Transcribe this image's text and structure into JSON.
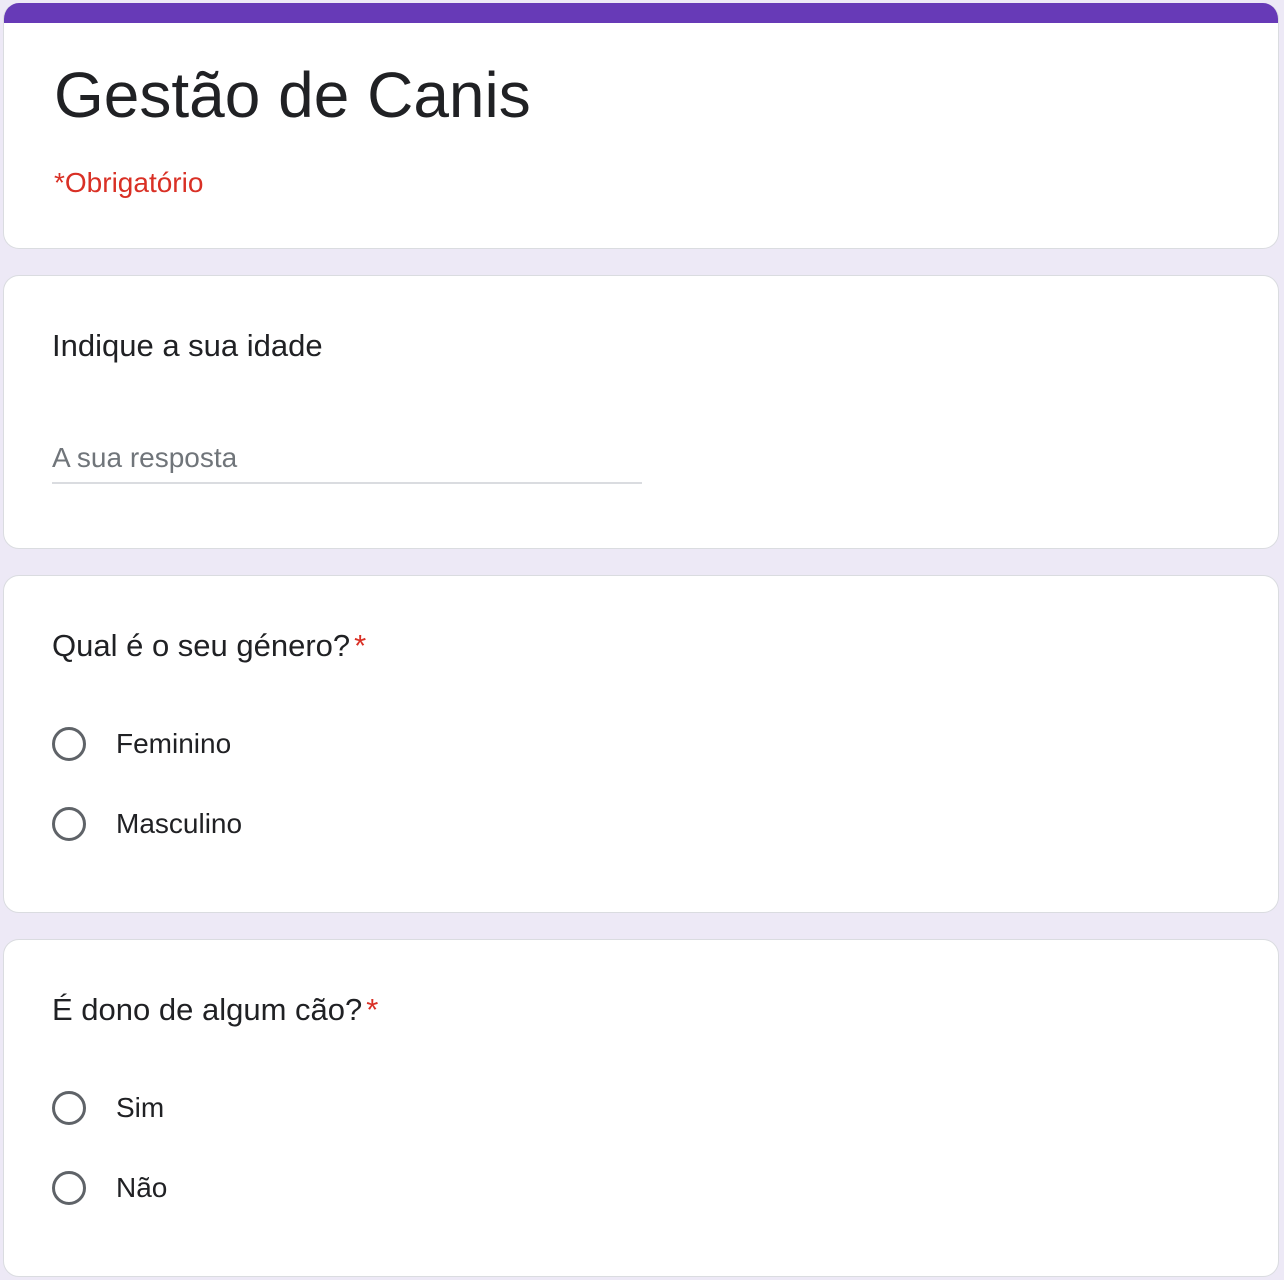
{
  "form": {
    "title": "Gestão de Canis",
    "required_note": "*Obrigatório",
    "accent_color": "#673ab7",
    "required_color": "#d93025"
  },
  "questions": [
    {
      "title": "Indique a sua idade",
      "type": "short-answer",
      "placeholder": "A sua resposta",
      "value": ""
    },
    {
      "title": "Qual é o seu género?",
      "required_mark": "*",
      "type": "radio",
      "options": [
        "Feminino",
        "Masculino"
      ]
    },
    {
      "title": "É dono de algum cão?",
      "required_mark": "*",
      "type": "radio",
      "options": [
        "Sim",
        "Não"
      ]
    }
  ]
}
